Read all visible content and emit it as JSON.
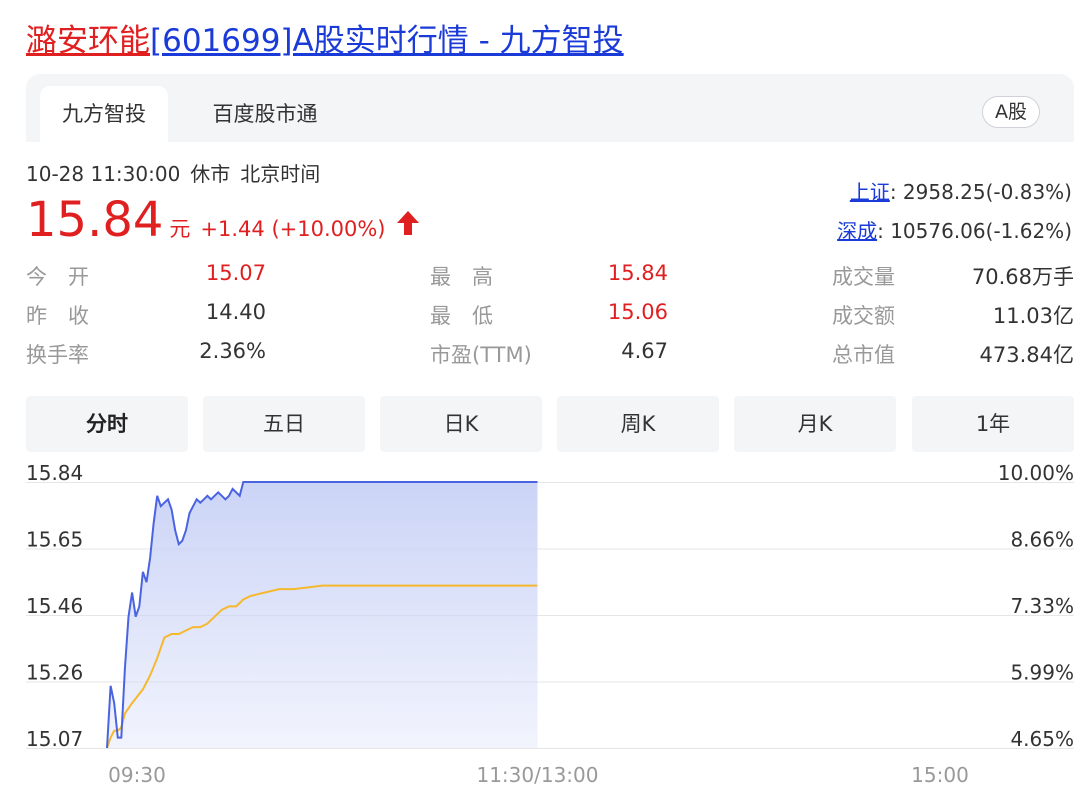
{
  "page": {
    "title_name": "潞安环能",
    "title_rest": "[601699]A股实时行情 - 九方智投"
  },
  "tabs": [
    {
      "label": "九方智投",
      "active": true
    },
    {
      "label": "百度股市通",
      "active": false
    }
  ],
  "market_badge": "A股",
  "quote": {
    "datetime": "10-28 11:30:00",
    "status": "休市",
    "timezone": "北京时间",
    "price": "15.84",
    "unit": "元",
    "change": "+1.44 (+10.00%)",
    "direction": "up"
  },
  "indices": [
    {
      "name": "上证",
      "value": ": 2958.25(-0.83%)"
    },
    {
      "name": "深成",
      "value": ": 10576.06(-1.62%)"
    }
  ],
  "stats": {
    "open": {
      "label": "今　开",
      "value": "15.07"
    },
    "prev": {
      "label": "昨　收",
      "value": "14.40"
    },
    "turnover": {
      "label": "换手率",
      "value": "2.36%"
    },
    "high": {
      "label": "最　高",
      "value": "15.84"
    },
    "low": {
      "label": "最　低",
      "value": "15.06"
    },
    "pe": {
      "label": "市盈(TTM)",
      "value": "4.67"
    },
    "volume": {
      "label": "成交量",
      "value": "70.68万手"
    },
    "amount": {
      "label": "成交额",
      "value": "11.03亿"
    },
    "marketcap": {
      "label": "总市值",
      "value": "473.84亿"
    }
  },
  "periods": [
    {
      "label": "分时",
      "active": true
    },
    {
      "label": "五日",
      "active": false
    },
    {
      "label": "日K",
      "active": false
    },
    {
      "label": "周K",
      "active": false
    },
    {
      "label": "月K",
      "active": false
    },
    {
      "label": "1年",
      "active": false
    }
  ],
  "colors": {
    "up_red": "#e02020",
    "link_blue": "#1a3bd8",
    "price_line": "#4a63e0",
    "avg_line": "#f5b82e",
    "area_fill": "#c9d2f6",
    "grid": "#e6e6e6"
  },
  "chart_data": {
    "type": "line",
    "ylim": [
      15.07,
      15.84
    ],
    "y_left_ticks": [
      "15.84",
      "15.65",
      "15.46",
      "15.26",
      "15.07"
    ],
    "y_right_ticks": [
      "10.00%",
      "8.66%",
      "7.33%",
      "5.99%",
      "4.65%"
    ],
    "x_ticks": [
      "09:30",
      "11:30/13:00",
      "15:00"
    ],
    "x_minutes_range": [
      0,
      240
    ],
    "series": [
      {
        "role": "price",
        "x": [
          0,
          1,
          2,
          3,
          4,
          5,
          6,
          7,
          8,
          9,
          10,
          11,
          12,
          13,
          14,
          15,
          16,
          17,
          18,
          19,
          20,
          21,
          22,
          23,
          24,
          25,
          26,
          27,
          28,
          29,
          30,
          31,
          32,
          33,
          34,
          35,
          36,
          37,
          38,
          39,
          40,
          42,
          45,
          50,
          60,
          80,
          100,
          120
        ],
        "values": [
          15.07,
          15.25,
          15.2,
          15.1,
          15.1,
          15.3,
          15.45,
          15.52,
          15.45,
          15.48,
          15.58,
          15.55,
          15.62,
          15.72,
          15.8,
          15.77,
          15.78,
          15.79,
          15.76,
          15.7,
          15.66,
          15.67,
          15.7,
          15.75,
          15.77,
          15.79,
          15.78,
          15.79,
          15.8,
          15.79,
          15.8,
          15.81,
          15.8,
          15.79,
          15.8,
          15.82,
          15.81,
          15.8,
          15.84,
          15.84,
          15.84,
          15.84,
          15.84,
          15.84,
          15.84,
          15.84,
          15.84,
          15.84
        ]
      },
      {
        "role": "average",
        "x": [
          0,
          1,
          2,
          3,
          4,
          5,
          7,
          10,
          12,
          14,
          16,
          18,
          20,
          22,
          24,
          26,
          28,
          30,
          32,
          34,
          36,
          38,
          40,
          44,
          48,
          52,
          60,
          70,
          80,
          90,
          100,
          110,
          120
        ],
        "values": [
          15.07,
          15.1,
          15.12,
          15.12,
          15.13,
          15.17,
          15.2,
          15.24,
          15.28,
          15.33,
          15.39,
          15.4,
          15.4,
          15.41,
          15.42,
          15.42,
          15.43,
          15.45,
          15.47,
          15.48,
          15.48,
          15.5,
          15.51,
          15.52,
          15.53,
          15.53,
          15.54,
          15.54,
          15.54,
          15.54,
          15.54,
          15.54,
          15.54
        ]
      }
    ]
  }
}
